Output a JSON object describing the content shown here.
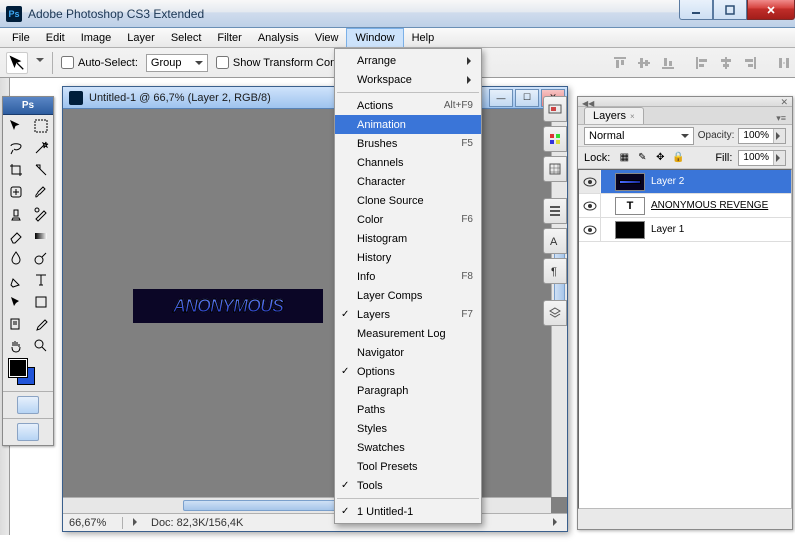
{
  "window": {
    "title": "Adobe Photoshop CS3 Extended"
  },
  "menubar": [
    "File",
    "Edit",
    "Image",
    "Layer",
    "Select",
    "Filter",
    "Analysis",
    "View",
    "Window",
    "Help"
  ],
  "active_menu_index": 8,
  "optbar": {
    "auto_select": "Auto-Select:",
    "group": "Group",
    "show_tc": "Show Transform Cont"
  },
  "document": {
    "title": "Untitled-1 @ 66,7% (Layer 2, RGB/8)",
    "zoom": "66,67%",
    "status": "Doc: 82,3K/156,4K",
    "canvas_text": "ANONYMOUS"
  },
  "dropdown": {
    "groups": [
      [
        {
          "label": "Arrange",
          "sub": true
        },
        {
          "label": "Workspace",
          "sub": true
        }
      ],
      [
        {
          "label": "Actions",
          "shortcut": "Alt+F9"
        },
        {
          "label": "Animation",
          "selected": true
        },
        {
          "label": "Brushes",
          "shortcut": "F5"
        },
        {
          "label": "Channels"
        },
        {
          "label": "Character"
        },
        {
          "label": "Clone Source"
        },
        {
          "label": "Color",
          "shortcut": "F6"
        },
        {
          "label": "Histogram"
        },
        {
          "label": "History"
        },
        {
          "label": "Info",
          "shortcut": "F8"
        },
        {
          "label": "Layer Comps"
        },
        {
          "label": "Layers",
          "shortcut": "F7",
          "checked": true
        },
        {
          "label": "Measurement Log"
        },
        {
          "label": "Navigator"
        },
        {
          "label": "Options",
          "checked": true
        },
        {
          "label": "Paragraph"
        },
        {
          "label": "Paths"
        },
        {
          "label": "Styles"
        },
        {
          "label": "Swatches"
        },
        {
          "label": "Tool Presets"
        },
        {
          "label": "Tools",
          "checked": true
        }
      ],
      [
        {
          "label": "1 Untitled-1",
          "checked": true
        }
      ]
    ]
  },
  "layers_panel": {
    "tab": "Layers",
    "blend": "Normal",
    "opacity_label": "Opacity:",
    "opacity": "100%",
    "lock_label": "Lock:",
    "fill_label": "Fill:",
    "fill": "100%",
    "rows": [
      {
        "name": "Layer 2",
        "selected": true,
        "thumb": "sel"
      },
      {
        "name": "ANONYMOUS REVENGE",
        "underline": true,
        "thumb": "text"
      },
      {
        "name": "Layer 1",
        "thumb": "dark"
      }
    ]
  }
}
